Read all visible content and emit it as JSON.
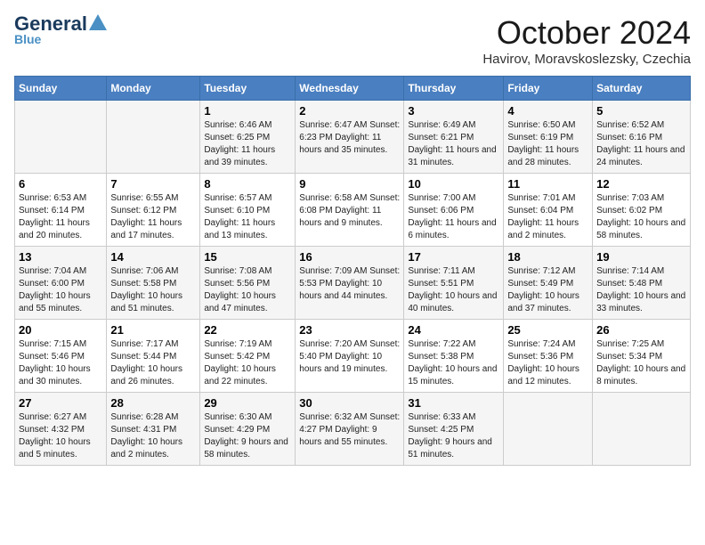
{
  "header": {
    "logo_general": "General",
    "logo_blue": "Blue",
    "month_title": "October 2024",
    "location": "Havirov, Moravskoslezsky, Czechia"
  },
  "days_of_week": [
    "Sunday",
    "Monday",
    "Tuesday",
    "Wednesday",
    "Thursday",
    "Friday",
    "Saturday"
  ],
  "weeks": [
    [
      {
        "day": "",
        "info": ""
      },
      {
        "day": "",
        "info": ""
      },
      {
        "day": "1",
        "info": "Sunrise: 6:46 AM\nSunset: 6:25 PM\nDaylight: 11 hours and 39 minutes."
      },
      {
        "day": "2",
        "info": "Sunrise: 6:47 AM\nSunset: 6:23 PM\nDaylight: 11 hours and 35 minutes."
      },
      {
        "day": "3",
        "info": "Sunrise: 6:49 AM\nSunset: 6:21 PM\nDaylight: 11 hours and 31 minutes."
      },
      {
        "day": "4",
        "info": "Sunrise: 6:50 AM\nSunset: 6:19 PM\nDaylight: 11 hours and 28 minutes."
      },
      {
        "day": "5",
        "info": "Sunrise: 6:52 AM\nSunset: 6:16 PM\nDaylight: 11 hours and 24 minutes."
      }
    ],
    [
      {
        "day": "6",
        "info": "Sunrise: 6:53 AM\nSunset: 6:14 PM\nDaylight: 11 hours and 20 minutes."
      },
      {
        "day": "7",
        "info": "Sunrise: 6:55 AM\nSunset: 6:12 PM\nDaylight: 11 hours and 17 minutes."
      },
      {
        "day": "8",
        "info": "Sunrise: 6:57 AM\nSunset: 6:10 PM\nDaylight: 11 hours and 13 minutes."
      },
      {
        "day": "9",
        "info": "Sunrise: 6:58 AM\nSunset: 6:08 PM\nDaylight: 11 hours and 9 minutes."
      },
      {
        "day": "10",
        "info": "Sunrise: 7:00 AM\nSunset: 6:06 PM\nDaylight: 11 hours and 6 minutes."
      },
      {
        "day": "11",
        "info": "Sunrise: 7:01 AM\nSunset: 6:04 PM\nDaylight: 11 hours and 2 minutes."
      },
      {
        "day": "12",
        "info": "Sunrise: 7:03 AM\nSunset: 6:02 PM\nDaylight: 10 hours and 58 minutes."
      }
    ],
    [
      {
        "day": "13",
        "info": "Sunrise: 7:04 AM\nSunset: 6:00 PM\nDaylight: 10 hours and 55 minutes."
      },
      {
        "day": "14",
        "info": "Sunrise: 7:06 AM\nSunset: 5:58 PM\nDaylight: 10 hours and 51 minutes."
      },
      {
        "day": "15",
        "info": "Sunrise: 7:08 AM\nSunset: 5:56 PM\nDaylight: 10 hours and 47 minutes."
      },
      {
        "day": "16",
        "info": "Sunrise: 7:09 AM\nSunset: 5:53 PM\nDaylight: 10 hours and 44 minutes."
      },
      {
        "day": "17",
        "info": "Sunrise: 7:11 AM\nSunset: 5:51 PM\nDaylight: 10 hours and 40 minutes."
      },
      {
        "day": "18",
        "info": "Sunrise: 7:12 AM\nSunset: 5:49 PM\nDaylight: 10 hours and 37 minutes."
      },
      {
        "day": "19",
        "info": "Sunrise: 7:14 AM\nSunset: 5:48 PM\nDaylight: 10 hours and 33 minutes."
      }
    ],
    [
      {
        "day": "20",
        "info": "Sunrise: 7:15 AM\nSunset: 5:46 PM\nDaylight: 10 hours and 30 minutes."
      },
      {
        "day": "21",
        "info": "Sunrise: 7:17 AM\nSunset: 5:44 PM\nDaylight: 10 hours and 26 minutes."
      },
      {
        "day": "22",
        "info": "Sunrise: 7:19 AM\nSunset: 5:42 PM\nDaylight: 10 hours and 22 minutes."
      },
      {
        "day": "23",
        "info": "Sunrise: 7:20 AM\nSunset: 5:40 PM\nDaylight: 10 hours and 19 minutes."
      },
      {
        "day": "24",
        "info": "Sunrise: 7:22 AM\nSunset: 5:38 PM\nDaylight: 10 hours and 15 minutes."
      },
      {
        "day": "25",
        "info": "Sunrise: 7:24 AM\nSunset: 5:36 PM\nDaylight: 10 hours and 12 minutes."
      },
      {
        "day": "26",
        "info": "Sunrise: 7:25 AM\nSunset: 5:34 PM\nDaylight: 10 hours and 8 minutes."
      }
    ],
    [
      {
        "day": "27",
        "info": "Sunrise: 6:27 AM\nSunset: 4:32 PM\nDaylight: 10 hours and 5 minutes."
      },
      {
        "day": "28",
        "info": "Sunrise: 6:28 AM\nSunset: 4:31 PM\nDaylight: 10 hours and 2 minutes."
      },
      {
        "day": "29",
        "info": "Sunrise: 6:30 AM\nSunset: 4:29 PM\nDaylight: 9 hours and 58 minutes."
      },
      {
        "day": "30",
        "info": "Sunrise: 6:32 AM\nSunset: 4:27 PM\nDaylight: 9 hours and 55 minutes."
      },
      {
        "day": "31",
        "info": "Sunrise: 6:33 AM\nSunset: 4:25 PM\nDaylight: 9 hours and 51 minutes."
      },
      {
        "day": "",
        "info": ""
      },
      {
        "day": "",
        "info": ""
      }
    ]
  ]
}
